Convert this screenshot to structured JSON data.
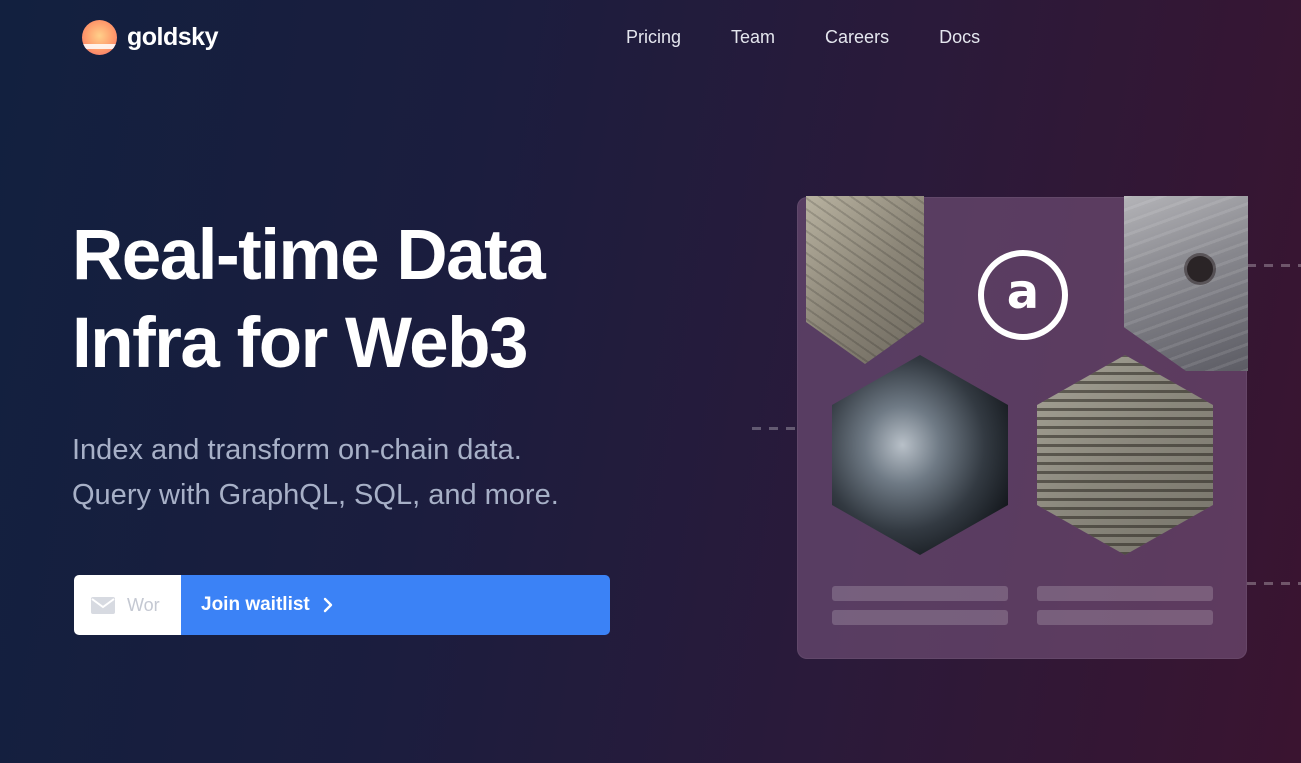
{
  "brand": {
    "name": "goldsky"
  },
  "nav": {
    "links": [
      "Pricing",
      "Team",
      "Careers",
      "Docs"
    ]
  },
  "hero": {
    "title_line1": "Real-time Data",
    "title_line2": "Infra for Web3",
    "subtitle_line1": "Index and transform on-chain data.",
    "subtitle_line2": "Query with GraphQL, SQL, and more."
  },
  "waitlist": {
    "email_placeholder": "Wor",
    "button_label": "Join waitlist"
  },
  "illustration": {
    "logo_letter": "a"
  },
  "colors": {
    "accent": "#3b82f6",
    "background_start": "#12203f",
    "background_end": "#3a1430",
    "subtitle": "#a7b0c7"
  }
}
